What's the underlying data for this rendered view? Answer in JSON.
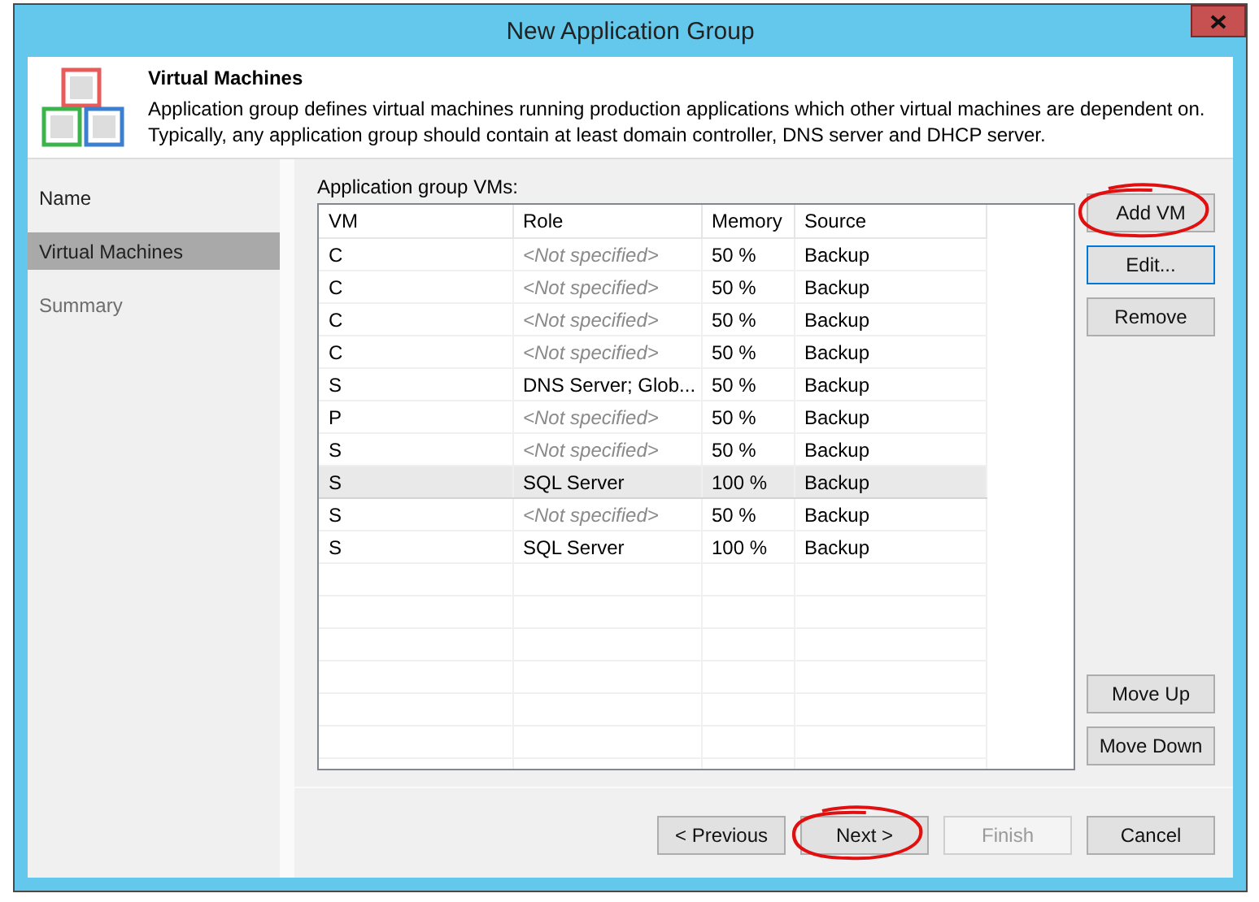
{
  "window": {
    "title": "New Application Group"
  },
  "header": {
    "title": "Virtual Machines",
    "description": "Application group defines virtual machines running production applications which other virtual machines are dependent on. Typically, any application group should contain at least domain controller, DNS server and DHCP server."
  },
  "sidebar": {
    "items": [
      {
        "label": "Name",
        "selected": false,
        "disabled": false
      },
      {
        "label": "Virtual Machines",
        "selected": true,
        "disabled": false
      },
      {
        "label": "Summary",
        "selected": false,
        "disabled": true
      }
    ]
  },
  "table": {
    "label": "Application group VMs:",
    "columns": [
      "VM",
      "Role",
      "Memory",
      "Source"
    ],
    "rows": [
      {
        "vm": "C",
        "role": "<Not specified>",
        "role_specified": false,
        "memory": "50 %",
        "source": "Backup",
        "selected": false
      },
      {
        "vm": "C",
        "role": "<Not specified>",
        "role_specified": false,
        "memory": "50 %",
        "source": "Backup",
        "selected": false
      },
      {
        "vm": "C",
        "role": "<Not specified>",
        "role_specified": false,
        "memory": "50 %",
        "source": "Backup",
        "selected": false
      },
      {
        "vm": "C",
        "role": "<Not specified>",
        "role_specified": false,
        "memory": "50 %",
        "source": "Backup",
        "selected": false
      },
      {
        "vm": "S",
        "role": "DNS Server; Glob...",
        "role_specified": true,
        "memory": "50 %",
        "source": "Backup",
        "selected": false
      },
      {
        "vm": "P",
        "role": "<Not specified>",
        "role_specified": false,
        "memory": "50 %",
        "source": "Backup",
        "selected": false
      },
      {
        "vm": "S",
        "role": "<Not specified>",
        "role_specified": false,
        "memory": "50 %",
        "source": "Backup",
        "selected": false
      },
      {
        "vm": "S",
        "role": "SQL Server",
        "role_specified": true,
        "memory": "100 %",
        "source": "Backup",
        "selected": true
      },
      {
        "vm": "S",
        "role": "<Not specified>",
        "role_specified": false,
        "memory": "50 %",
        "source": "Backup",
        "selected": false
      },
      {
        "vm": "S",
        "role": "SQL Server",
        "role_specified": true,
        "memory": "100 %",
        "source": "Backup",
        "selected": false
      }
    ]
  },
  "side_buttons_top": [
    {
      "label": "Add VM",
      "focused": false,
      "circled": true
    },
    {
      "label": "Edit...",
      "focused": true,
      "circled": false
    },
    {
      "label": "Remove",
      "focused": false,
      "circled": false
    }
  ],
  "side_buttons_bottom": [
    {
      "label": "Move Up",
      "focused": false,
      "circled": false
    },
    {
      "label": "Move Down",
      "focused": false,
      "circled": false
    }
  ],
  "footer_buttons": [
    {
      "label": "< Previous",
      "disabled": false,
      "circled": false
    },
    {
      "label": "Next >",
      "disabled": false,
      "circled": true
    },
    {
      "label": "Finish",
      "disabled": true,
      "circled": false
    },
    {
      "label": "Cancel",
      "disabled": false,
      "circled": false
    }
  ]
}
